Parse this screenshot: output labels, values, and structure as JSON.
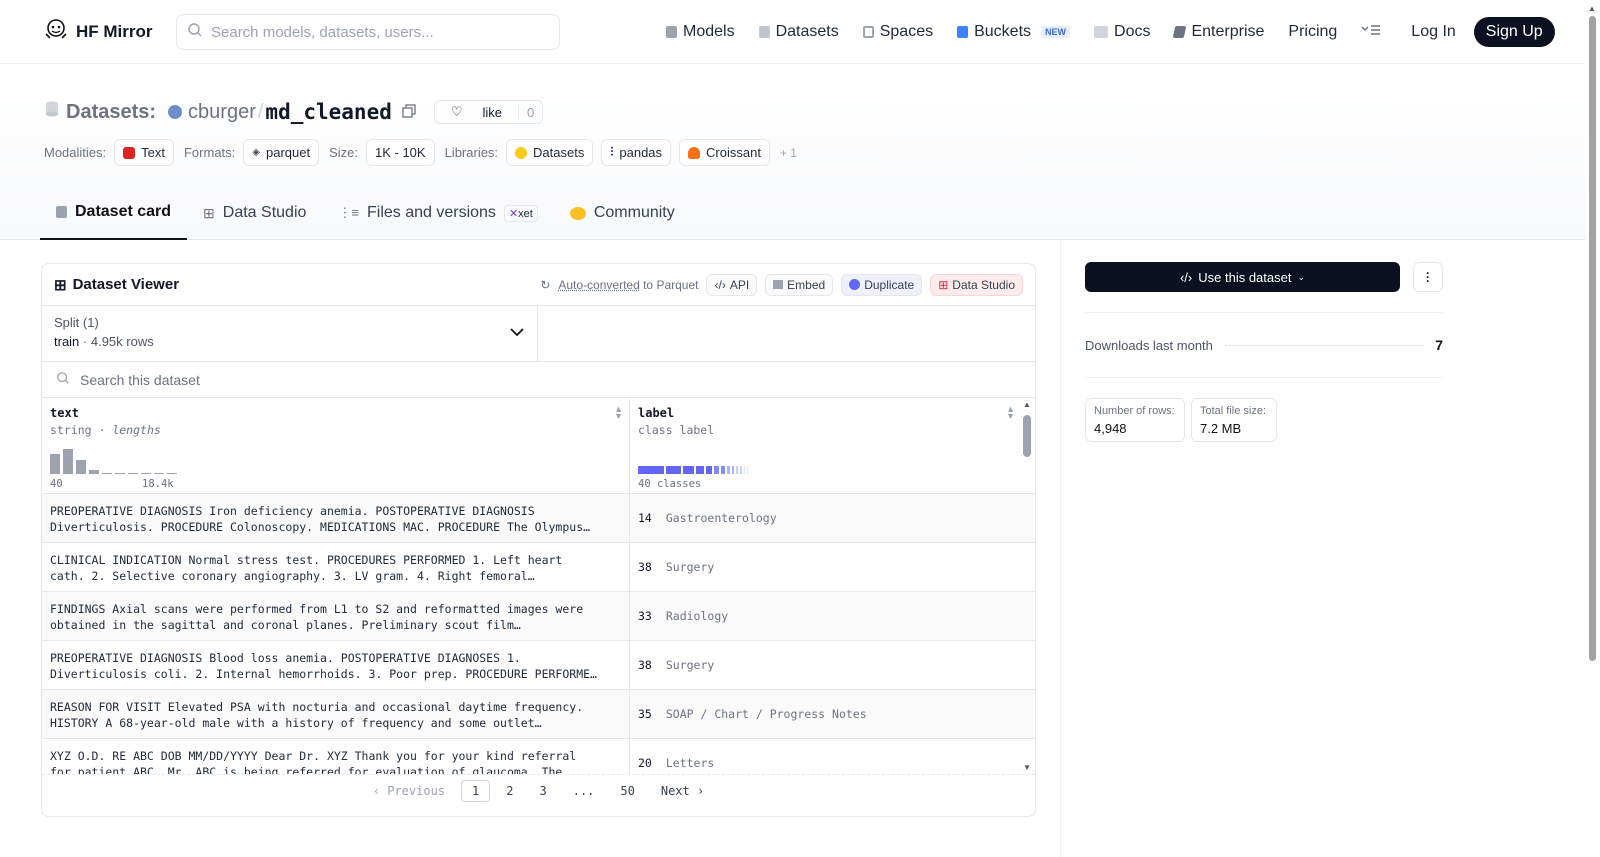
{
  "nav": {
    "brand": "HF Mirror",
    "search_placeholder": "Search models, datasets, users...",
    "links": [
      "Models",
      "Datasets",
      "Spaces",
      "Buckets",
      "Docs",
      "Enterprise",
      "Pricing"
    ],
    "new_badge": "NEW",
    "login": "Log In",
    "signup": "Sign Up"
  },
  "header": {
    "section": "Datasets:",
    "owner": "cburger",
    "sep": "/",
    "name": "md_cleaned",
    "like_label": "like",
    "like_count": "0",
    "modalities_label": "Modalities:",
    "modality": "Text",
    "formats_label": "Formats:",
    "format": "parquet",
    "size_label": "Size:",
    "size": "1K - 10K",
    "libraries_label": "Libraries:",
    "libraries": [
      "Datasets",
      "pandas",
      "Croissant"
    ],
    "more_libs": "+ 1"
  },
  "tabs": [
    "Dataset card",
    "Data Studio",
    "Files and versions",
    "Community"
  ],
  "xet_badge": "xet",
  "viewer": {
    "title": "Dataset Viewer",
    "auto_converted": "Auto-converted",
    "to_parquet": " to Parquet",
    "api": "API",
    "embed": "Embed",
    "duplicate": "Duplicate",
    "data_studio": "Data Studio",
    "split_label": "Split (1)",
    "split_name": "train",
    "split_rows": "4.95k rows",
    "search_placeholder": "Search this dataset",
    "col1_name": "text",
    "col1_type": "string",
    "col1_sub": "lengths",
    "col1_min": "40",
    "col1_max": "18.4k",
    "col2_name": "label",
    "col2_type": "class label",
    "col2_classes": "40 classes",
    "rows": [
      {
        "l1": "PREOPERATIVE DIAGNOSIS Iron deficiency anemia. POSTOPERATIVE DIAGNOSIS",
        "l2": "Diverticulosis. PROCEDURE Colonoscopy. MEDICATIONS MAC. PROCEDURE The Olympus…",
        "id": "14",
        "label": "Gastroenterology"
      },
      {
        "l1": "CLINICAL INDICATION Normal stress test. PROCEDURES PERFORMED 1. Left heart",
        "l2": "cath. 2. Selective coronary angiography. 3. LV gram. 4. Right femoral…",
        "id": "38",
        "label": "Surgery"
      },
      {
        "l1": "FINDINGS Axial scans were performed from L1 to S2 and reformatted images were",
        "l2": "obtained in the sagittal and coronal planes. Preliminary scout film…",
        "id": "33",
        "label": "Radiology"
      },
      {
        "l1": "PREOPERATIVE DIAGNOSIS Blood loss anemia. POSTOPERATIVE DIAGNOSES 1.",
        "l2": "Diverticulosis coli. 2. Internal hemorrhoids. 3. Poor prep. PROCEDURE PERFORME…",
        "id": "38",
        "label": "Surgery"
      },
      {
        "l1": "REASON FOR VISIT Elevated PSA with nocturia and occasional daytime frequency.",
        "l2": "HISTORY A 68-year-old male with a history of frequency and some outlet…",
        "id": "35",
        "label": "SOAP / Chart / Progress Notes"
      },
      {
        "l1": "XYZ O.D. RE ABC DOB MM/DD/YYYY Dear Dr. XYZ Thank you for your kind referral",
        "l2": "for patient ABC. Mr. ABC is being referred for evaluation of glaucoma. The…",
        "id": "20",
        "label": "Letters"
      }
    ],
    "pager": {
      "prev": "Previous",
      "pages": [
        "1",
        "2",
        "3",
        "...",
        "50"
      ],
      "next": "Next"
    }
  },
  "sidebar": {
    "use_label": "Use this dataset",
    "downloads_label": "Downloads last month",
    "downloads": "7",
    "rows_label": "Number of rows:",
    "rows": "4,948",
    "size_label": "Total file size:",
    "size": "7.2 MB"
  }
}
